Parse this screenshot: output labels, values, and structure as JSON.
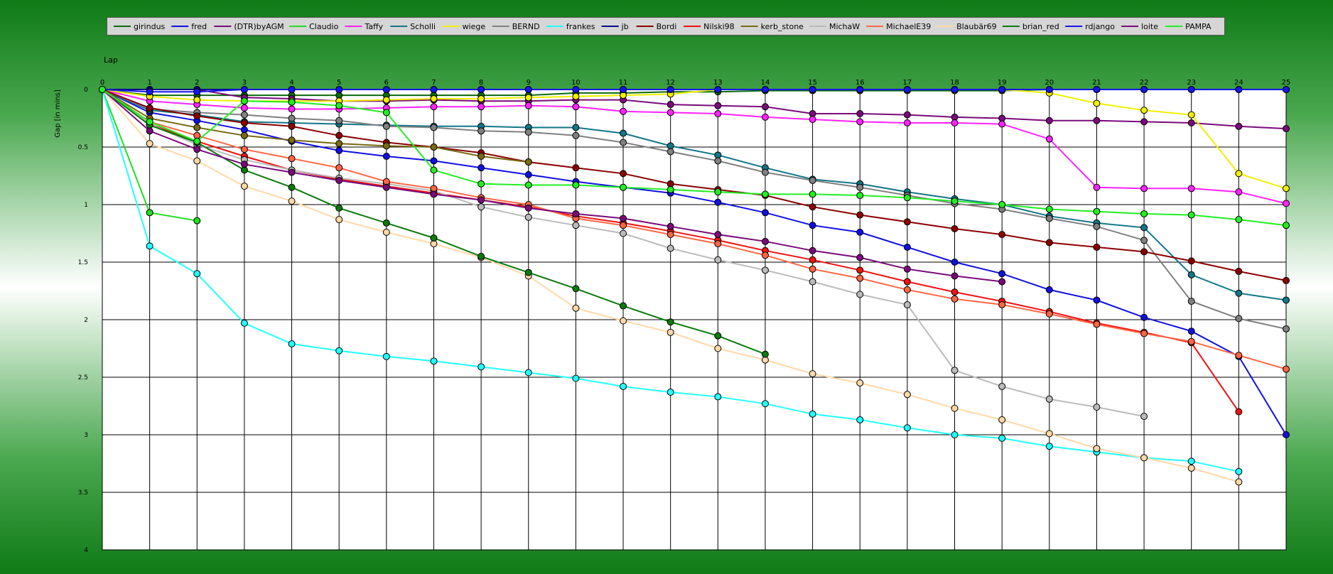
{
  "chart_data": {
    "type": "line",
    "xlabel": "Lap",
    "ylabel": "Gap [in mins]",
    "xlim": [
      0,
      25
    ],
    "ylim": [
      0,
      4
    ],
    "y_inverted": true,
    "x_ticks": [
      0,
      1,
      2,
      3,
      4,
      5,
      6,
      7,
      8,
      9,
      10,
      11,
      12,
      13,
      14,
      15,
      16,
      17,
      18,
      19,
      20,
      21,
      22,
      23,
      24,
      25
    ],
    "y_ticks": [
      0,
      0.5,
      1,
      1.5,
      2,
      2.5,
      3,
      3.5,
      4
    ],
    "grid": true,
    "legend_position": "top",
    "series": [
      {
        "name": "girindus",
        "color": "#0b6b0b",
        "values": [
          0,
          0.05,
          0.05,
          0.05,
          0.05,
          0.05,
          0.05,
          0.05,
          0.05,
          0.05,
          0.03,
          0.03,
          0.02,
          0.02,
          0.01,
          0.01,
          0.01,
          0.01,
          0.01,
          0.01,
          0,
          0,
          0,
          0,
          0,
          0
        ]
      },
      {
        "name": "fred",
        "color": "#1010e0",
        "values": [
          0,
          0.2,
          0.27,
          0.35,
          0.45,
          0.53,
          0.58,
          0.62,
          0.68,
          0.74,
          0.8,
          0.85,
          0.9,
          0.98,
          1.07,
          1.18,
          1.24,
          1.37,
          1.5,
          1.6,
          1.74,
          1.83,
          1.98,
          2.1,
          2.32,
          3.0
        ]
      },
      {
        "name": "(DTR)byAGM",
        "color": "#7a0a7a",
        "values": [
          0,
          0,
          0,
          0.07,
          0.08,
          0.1,
          0.1,
          0.09,
          0.1,
          0.1,
          0.09,
          0.09,
          0.13,
          0.14,
          0.15,
          0.21,
          0.21,
          0.22,
          0.24,
          0.25,
          0.27,
          0.27,
          0.28,
          0.29,
          0.32,
          0.34
        ]
      },
      {
        "name": "Claudio",
        "color": "#22dd22",
        "values": [
          0,
          1.07,
          1.14
        ]
      },
      {
        "name": "Taffy",
        "color": "#ff22ff",
        "values": [
          0,
          0.1,
          0.13,
          0.16,
          0.17,
          0.17,
          0.16,
          0.15,
          0.15,
          0.14,
          0.15,
          0.19,
          0.2,
          0.21,
          0.24,
          0.26,
          0.28,
          0.29,
          0.29,
          0.3,
          0.43,
          0.85,
          0.86,
          0.86,
          0.89,
          0.99
        ]
      },
      {
        "name": "Scholli",
        "color": "#117788",
        "values": [
          0,
          0.18,
          0.22,
          0.28,
          0.29,
          0.3,
          0.31,
          0.32,
          0.32,
          0.33,
          0.33,
          0.38,
          0.49,
          0.57,
          0.68,
          0.78,
          0.82,
          0.89,
          0.95,
          1.0,
          1.1,
          1.16,
          1.2,
          1.61,
          1.77,
          1.83
        ]
      },
      {
        "name": "wiege",
        "color": "#f0f000",
        "values": [
          0,
          0.06,
          0.09,
          0.1,
          0.1,
          0.1,
          0.09,
          0.08,
          0.08,
          0.07,
          0.06,
          0.05,
          0.04,
          0.0,
          0.0,
          0.0,
          0.0,
          0.0,
          0.0,
          0.0,
          0.03,
          0.12,
          0.18,
          0.22,
          0.73,
          0.86
        ]
      },
      {
        "name": "BERND",
        "color": "#808080",
        "values": [
          0,
          0.17,
          0.2,
          0.22,
          0.25,
          0.27,
          0.32,
          0.33,
          0.36,
          0.37,
          0.4,
          0.46,
          0.54,
          0.62,
          0.72,
          0.79,
          0.85,
          0.92,
          0.99,
          1.04,
          1.12,
          1.19,
          1.31,
          1.84,
          1.99,
          2.08
        ]
      },
      {
        "name": "frankes",
        "color": "#22ffff",
        "values": [
          0,
          1.36,
          1.6,
          2.03,
          2.21,
          2.27,
          2.32,
          2.36,
          2.41,
          2.46,
          2.51,
          2.58,
          2.63,
          2.67,
          2.73,
          2.82,
          2.87,
          2.94,
          3.0,
          3.03,
          3.1,
          3.15,
          3.2,
          3.23,
          3.32
        ]
      },
      {
        "name": "jb",
        "color": "#00008b",
        "values": [
          0,
          0,
          0,
          0,
          0,
          0,
          0,
          0,
          0,
          0,
          0,
          0,
          0,
          0,
          0,
          0,
          0,
          0,
          0,
          0,
          0,
          0,
          0,
          0,
          0,
          0
        ]
      },
      {
        "name": "Bordi",
        "color": "#8b0000",
        "values": [
          0,
          0.16,
          0.23,
          0.29,
          0.32,
          0.4,
          0.46,
          0.5,
          0.55,
          0.63,
          0.68,
          0.73,
          0.82,
          0.87,
          0.92,
          1.02,
          1.09,
          1.15,
          1.21,
          1.26,
          1.33,
          1.37,
          1.41,
          1.49,
          1.58,
          1.66
        ]
      },
      {
        "name": "Nilski98",
        "color": "#ee1111",
        "values": [
          0,
          0.3,
          0.45,
          0.58,
          0.7,
          0.78,
          0.84,
          0.9,
          0.96,
          1.02,
          1.1,
          1.16,
          1.23,
          1.31,
          1.4,
          1.48,
          1.57,
          1.67,
          1.76,
          1.84,
          1.93,
          2.03,
          2.11,
          2.2,
          2.8
        ]
      },
      {
        "name": "kerb_stone",
        "color": "#7a6a10",
        "values": [
          0,
          0.25,
          0.33,
          0.4,
          0.44,
          0.47,
          0.49,
          0.5,
          0.58,
          0.63
        ]
      },
      {
        "name": "MichaW",
        "color": "#bbbbbb",
        "values": [
          0,
          0.3,
          0.48,
          0.61,
          0.7,
          0.77,
          0.82,
          0.88,
          1.02,
          1.11,
          1.18,
          1.25,
          1.38,
          1.48,
          1.57,
          1.67,
          1.78,
          1.87,
          2.44,
          2.58,
          2.69,
          2.76,
          2.84
        ]
      },
      {
        "name": "MichaelE39",
        "color": "#ff6644",
        "values": [
          0,
          0.28,
          0.4,
          0.52,
          0.6,
          0.68,
          0.8,
          0.86,
          0.94,
          1.0,
          1.12,
          1.18,
          1.26,
          1.34,
          1.44,
          1.56,
          1.64,
          1.74,
          1.82,
          1.87,
          1.95,
          2.04,
          2.12,
          2.19,
          2.31,
          2.43
        ]
      },
      {
        "name": "Blaubär69",
        "color": "#ffd8a8",
        "values": [
          0,
          0.47,
          0.62,
          0.84,
          0.97,
          1.13,
          1.24,
          1.34,
          1.46,
          1.62,
          1.9,
          2.01,
          2.11,
          2.25,
          2.35,
          2.47,
          2.55,
          2.65,
          2.77,
          2.87,
          2.99,
          3.12,
          3.2,
          3.29,
          3.41
        ]
      },
      {
        "name": "brian_red",
        "color": "#0b7a0b",
        "values": [
          0,
          0.31,
          0.46,
          0.7,
          0.85,
          1.03,
          1.16,
          1.29,
          1.45,
          1.59,
          1.73,
          1.88,
          2.02,
          2.14,
          2.3
        ]
      },
      {
        "name": "rdjango",
        "color": "#1515ee",
        "values": [
          0,
          0.02,
          0.02,
          0,
          0,
          0,
          0,
          0,
          0,
          0,
          0,
          0,
          0,
          0,
          0,
          0,
          0,
          0,
          0,
          0,
          0,
          0,
          0,
          0,
          0,
          0
        ]
      },
      {
        "name": "loite",
        "color": "#7a0a7a",
        "values": [
          0,
          0.36,
          0.52,
          0.65,
          0.72,
          0.79,
          0.85,
          0.91,
          0.96,
          1.03,
          1.08,
          1.12,
          1.19,
          1.26,
          1.32,
          1.4,
          1.46,
          1.56,
          1.62,
          1.67
        ]
      },
      {
        "name": "PAMPA",
        "color": "#22ee22",
        "values": [
          0,
          0.28,
          0.45,
          0.1,
          0.11,
          0.14,
          0.2,
          0.7,
          0.82,
          0.83,
          0.83,
          0.85,
          0.87,
          0.89,
          0.91,
          0.91,
          0.92,
          0.94,
          0.97,
          1.0,
          1.04,
          1.06,
          1.08,
          1.09,
          1.13,
          1.18
        ]
      }
    ]
  }
}
